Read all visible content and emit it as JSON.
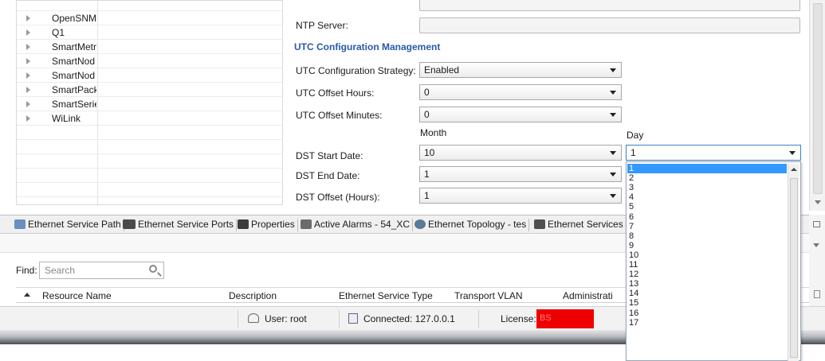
{
  "tree": {
    "items": [
      {
        "label": "OpenSNM"
      },
      {
        "label": "Q1"
      },
      {
        "label": "SmartMetr"
      },
      {
        "label": "SmartNod"
      },
      {
        "label": "SmartNod"
      },
      {
        "label": "SmartPack"
      },
      {
        "label": "SmartSerie"
      },
      {
        "label": "WiLink"
      }
    ]
  },
  "form": {
    "ntp_server_label": "NTP Server:",
    "ntp_server_value": "",
    "utc_section_title": "UTC Configuration Management",
    "utc_strategy_label": "UTC Configuration Strategy:",
    "utc_strategy_value": "Enabled",
    "utc_offset_hours_label": "UTC Offset Hours:",
    "utc_offset_hours_value": "0",
    "utc_offset_minutes_label": "UTC Offset Minutes:",
    "utc_offset_minutes_value": "0",
    "month_header": "Month",
    "day_header": "Day",
    "dst_start_label": "DST Start Date:",
    "dst_start_month": "10",
    "dst_start_day": "1",
    "dst_end_label": "DST End Date:",
    "dst_end_month": "1",
    "dst_offset_label": "DST Offset (Hours):",
    "dst_offset_value": "1"
  },
  "day_dropdown": {
    "options": [
      "1",
      "2",
      "3",
      "4",
      "5",
      "6",
      "7",
      "8",
      "9",
      "10",
      "11",
      "12",
      "13",
      "14",
      "15",
      "16",
      "17"
    ],
    "selected": "1"
  },
  "tabs": [
    {
      "label": "Ethernet Service Path",
      "icon": "network-path-icon"
    },
    {
      "label": "Ethernet Service Ports",
      "icon": "ports-icon"
    },
    {
      "label": "Properties",
      "icon": "properties-icon"
    },
    {
      "label": "Active Alarms - 54_XC",
      "icon": "alarm-bell-icon"
    },
    {
      "label": "Ethernet Topology - tes",
      "icon": "topology-icon"
    },
    {
      "label": "Ethernet Services",
      "icon": "services-icon"
    }
  ],
  "find": {
    "label": "Find:",
    "placeholder": "Search"
  },
  "table": {
    "columns": [
      "Resource Name",
      "Description",
      "Ethernet Service Type",
      "Transport VLAN",
      "Administrati"
    ]
  },
  "status": {
    "user": "User: root",
    "connected": "Connected: 127.0.0.1",
    "license_label": "License:",
    "license_value": "BS"
  },
  "colors": {
    "accent": "#2b5aa8",
    "selection": "#3399ff",
    "license_bg": "#ee0000"
  }
}
